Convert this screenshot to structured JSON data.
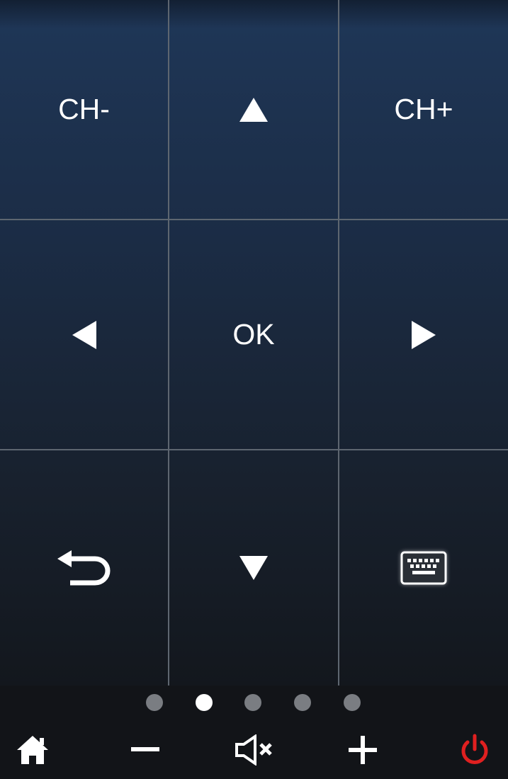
{
  "keypad": {
    "ch_minus_label": "CH-",
    "ch_plus_label": "CH+",
    "ok_label": "OK",
    "up_icon": "triangle-up-icon",
    "down_icon": "triangle-down-icon",
    "left_icon": "triangle-left-icon",
    "right_icon": "triangle-right-icon",
    "back_icon": "back-arrow-icon",
    "keyboard_icon": "keyboard-icon"
  },
  "pager": {
    "page_count": 5,
    "active_page": 2
  },
  "bottom_bar": {
    "items": [
      "home-icon",
      "volume-down-icon",
      "mute-icon",
      "volume-up-icon",
      "power-icon"
    ]
  },
  "colors": {
    "background_top": "#1f3758",
    "background_bottom": "#13171d",
    "grid_line": "#5e6670",
    "power": "#e02020",
    "dot_inactive": "#7a7d82",
    "dot_active": "#ffffff"
  }
}
